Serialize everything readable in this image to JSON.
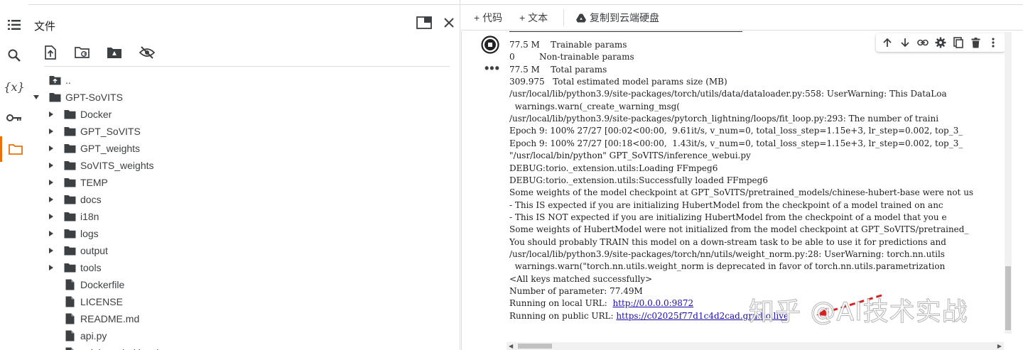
{
  "sidebar": {
    "title": "文件",
    "icons": [
      "list-icon",
      "search-icon",
      "variables-icon",
      "key-icon",
      "folder-icon"
    ],
    "variables_glyph": "{x}"
  },
  "file_tree": [
    {
      "label": "..",
      "type": "parent-folder",
      "depth": 0,
      "expandable": false
    },
    {
      "label": "GPT-SoVITS",
      "type": "folder",
      "depth": 0,
      "expanded": true
    },
    {
      "label": "Docker",
      "type": "folder",
      "depth": 1,
      "expanded": false
    },
    {
      "label": "GPT_SoVITS",
      "type": "folder",
      "depth": 1,
      "expanded": false
    },
    {
      "label": "GPT_weights",
      "type": "folder",
      "depth": 1,
      "expanded": false
    },
    {
      "label": "SoVITS_weights",
      "type": "folder",
      "depth": 1,
      "expanded": false
    },
    {
      "label": "TEMP",
      "type": "folder",
      "depth": 1,
      "expanded": false
    },
    {
      "label": "docs",
      "type": "folder",
      "depth": 1,
      "expanded": false
    },
    {
      "label": "i18n",
      "type": "folder",
      "depth": 1,
      "expanded": false
    },
    {
      "label": "logs",
      "type": "folder",
      "depth": 1,
      "expanded": false
    },
    {
      "label": "output",
      "type": "folder",
      "depth": 1,
      "expanded": false
    },
    {
      "label": "tools",
      "type": "folder",
      "depth": 1,
      "expanded": false
    },
    {
      "label": "Dockerfile",
      "type": "file",
      "depth": 1
    },
    {
      "label": "LICENSE",
      "type": "file",
      "depth": 1
    },
    {
      "label": "README.md",
      "type": "file",
      "depth": 1
    },
    {
      "label": "api.py",
      "type": "file",
      "depth": 1
    },
    {
      "label": "colab_webui.ipynb",
      "type": "file",
      "depth": 1
    }
  ],
  "toolbar": {
    "add_code": "+ 代码",
    "add_text": "+ 文本",
    "copy_to_drive": "复制到云端硬盘"
  },
  "output": {
    "lines": [
      "77.5 M    Trainable params",
      "0         Non-trainable params",
      "77.5 M    Total params",
      "309.975   Total estimated model params size (MB)",
      "/usr/local/lib/python3.9/site-packages/torch/utils/data/dataloader.py:558: UserWarning: This DataLoa",
      "  warnings.warn(_create_warning_msg(",
      "/usr/local/lib/python3.9/site-packages/pytorch_lightning/loops/fit_loop.py:293: The number of traini",
      "Epoch 9: 100% 27/27 [00:02<00:00,  9.61it/s, v_num=0, total_loss_step=1.15e+3, lr_step=0.002, top_3_",
      "Epoch 9: 100% 27/27 [00:18<00:00,  1.43it/s, v_num=0, total_loss_step=1.15e+3, lr_step=0.002, top_3_",
      "\"/usr/local/bin/python\" GPT_SoVITS/inference_webui.py",
      "DEBUG:torio._extension.utils:Loading FFmpeg6",
      "DEBUG:torio._extension.utils:Successfully loaded FFmpeg6",
      "Some weights of the model checkpoint at GPT_SoVITS/pretrained_models/chinese-hubert-base were not us",
      "- This IS expected if you are initializing HubertModel from the checkpoint of a model trained on anc",
      "- This IS NOT expected if you are initializing HubertModel from the checkpoint of a model that you e",
      "Some weights of HubertModel were not initialized from the model checkpoint at GPT_SoVITS/pretrained_",
      "You should probably TRAIN this model on a down-stream task to be able to use it for predictions and",
      "/usr/local/lib/python3.9/site-packages/torch/nn/utils/weight_norm.py:28: UserWarning: torch.nn.utils",
      "  warnings.warn(\"torch.nn.utils.weight_norm is deprecated in favor of torch.nn.utils.parametrization",
      "<All keys matched successfully>",
      "Number of parameter: 77.49M"
    ],
    "local_url_label": "Running on local URL:  ",
    "local_url": "http://0.0.0.0:9872",
    "public_url_label": "Running on public URL: ",
    "public_url": "https://c02025f77d1c4d2cad.gradio.live"
  },
  "watermark": "知乎 @AI技术实战",
  "colors": {
    "accent": "#e8710a",
    "link": "#1a0dab",
    "icon": "#3c4043",
    "border": "#dadce0"
  }
}
